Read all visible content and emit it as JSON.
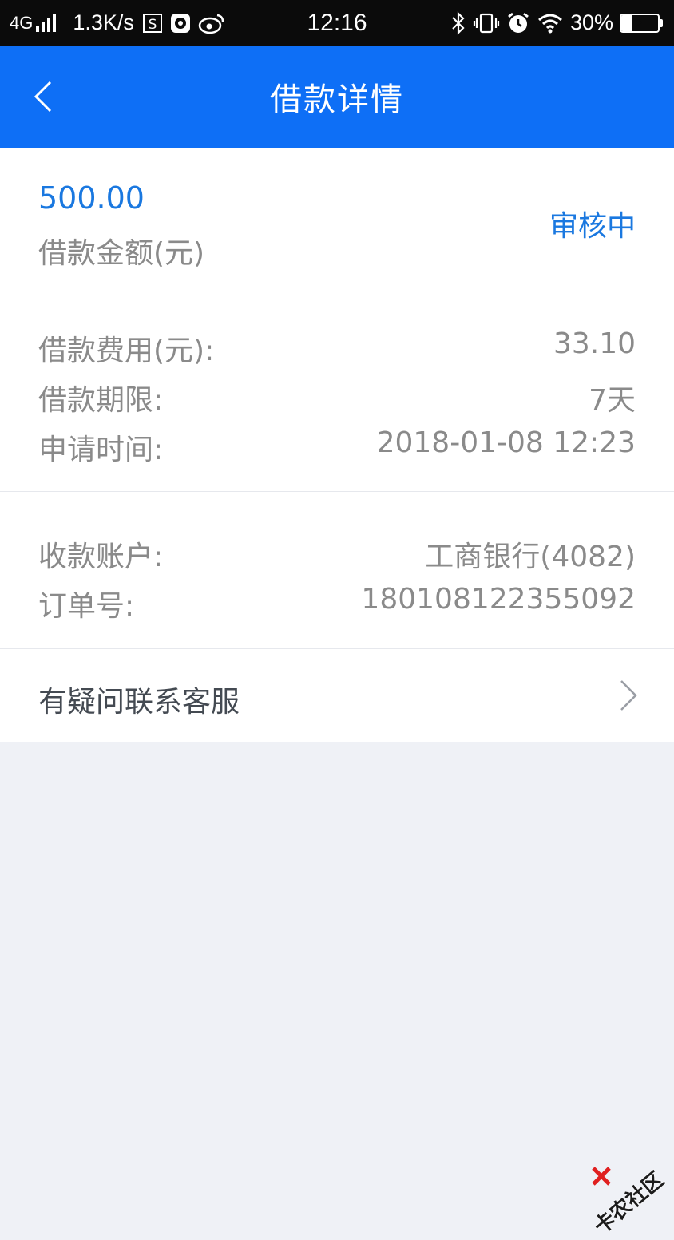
{
  "status_bar": {
    "network": "4G",
    "speed": "1.3K/s",
    "time": "12:16",
    "battery": "30%",
    "battery_level": 0.3
  },
  "nav": {
    "title": "借款详情",
    "back_icon": "chevron-left-icon"
  },
  "loan": {
    "amount": "500.00",
    "amount_label": "借款金额(元)",
    "status": "审核中"
  },
  "details": [
    {
      "label": "借款费用(元):",
      "value": "33.10"
    },
    {
      "label": "借款期限:",
      "value": "7天"
    },
    {
      "label": "申请时间:",
      "value": "2018-01-08 12:23"
    }
  ],
  "account": [
    {
      "label": "收款账户:",
      "value": "工商银行(4082)"
    },
    {
      "label": "订单号:",
      "value": "180108122355092"
    }
  ],
  "service": {
    "label": "有疑问联系客服",
    "icon": "chevron-right-icon"
  },
  "watermark": {
    "text": "卡农社区"
  },
  "colors": {
    "primary": "#0e6ff6",
    "accent_text": "#1a78e0",
    "secondary_text": "#8a8a8a",
    "background": "#eff1f6"
  }
}
